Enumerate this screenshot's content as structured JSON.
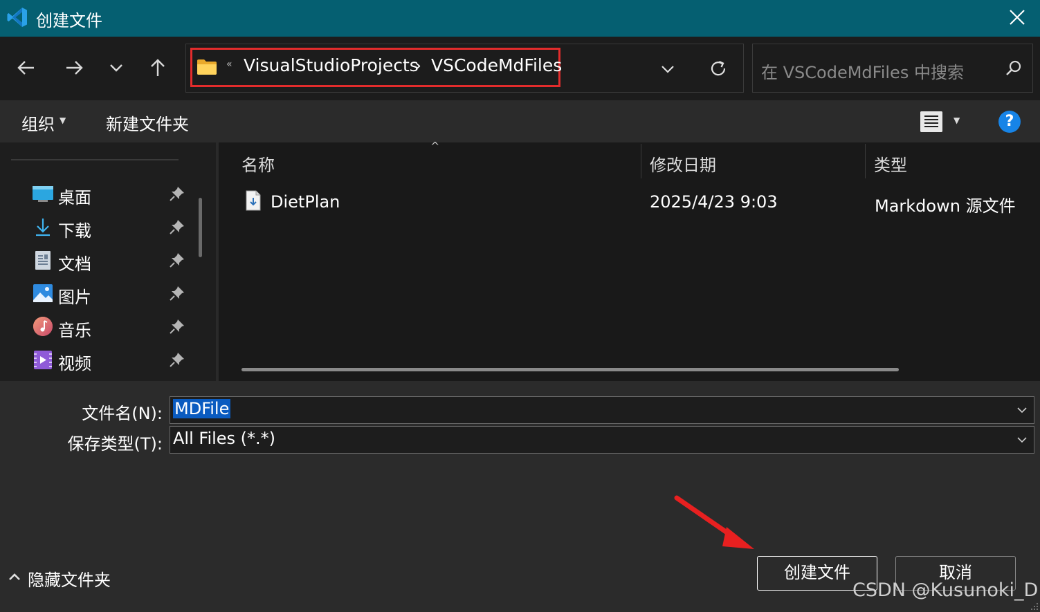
{
  "window": {
    "title": "创建文件",
    "accent_color": "#055f71",
    "app_icon": "vscode-icon",
    "close_icon": "close-icon"
  },
  "nav": {
    "back_icon": "back-arrow-icon",
    "forward_icon": "forward-arrow-icon",
    "recent_icon": "chevron-down-icon",
    "up_icon": "up-arrow-icon"
  },
  "address": {
    "overflow": "«",
    "segments": [
      "VisualStudioProjects",
      "VSCodeMdFiles"
    ],
    "separator": "›",
    "highlight_color": "#e32c2c"
  },
  "search": {
    "placeholder": "在 VSCodeMdFiles 中搜索"
  },
  "toolbar": {
    "organize": "组织",
    "new_folder": "新建文件夹",
    "help": "?"
  },
  "sidebar": {
    "items": [
      {
        "label": "桌面",
        "icon": "desktop-icon"
      },
      {
        "label": "下载",
        "icon": "download-icon"
      },
      {
        "label": "文档",
        "icon": "documents-icon"
      },
      {
        "label": "图片",
        "icon": "pictures-icon"
      },
      {
        "label": "音乐",
        "icon": "music-icon"
      },
      {
        "label": "视频",
        "icon": "videos-icon"
      }
    ]
  },
  "filelist": {
    "columns": [
      "名称",
      "修改日期",
      "类型"
    ],
    "rows": [
      {
        "name": "DietPlan",
        "date": "2025/4/23 9:03",
        "type": "Markdown 源文件"
      }
    ]
  },
  "form": {
    "filename_label": "文件名(N):",
    "filename_value": "MDFile",
    "filetype_label": "保存类型(T):",
    "filetype_value": "All Files (*.*)"
  },
  "footer": {
    "hide_folders": "隐藏文件夹",
    "create": "创建文件",
    "cancel": "取消",
    "watermark": "CSDN @Kusunoki_D"
  }
}
